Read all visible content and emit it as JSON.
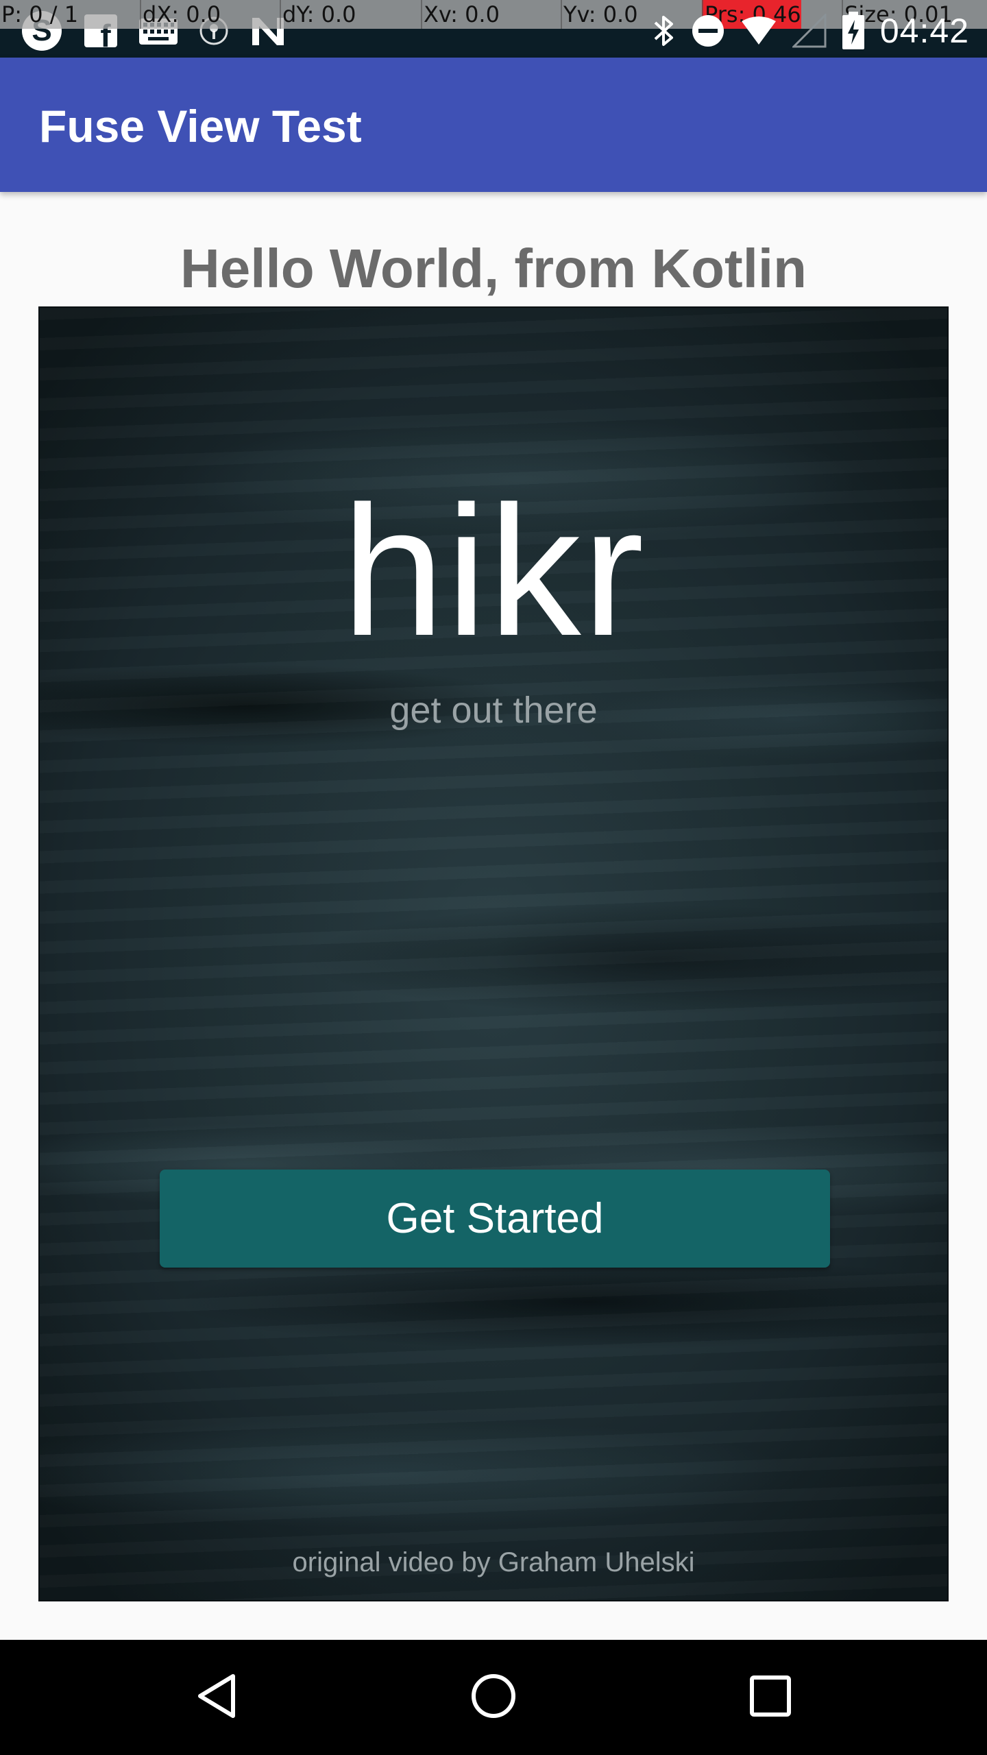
{
  "status_bar": {
    "debug": {
      "pointers": "P: 0 / 1",
      "dx": "dX: 0.0",
      "dy": "dY: 0.0",
      "xv": "Xv: 0.0",
      "yv": "Yv: 0.0",
      "pressure": "Prs: 0.46",
      "size": "Size: 0.01"
    },
    "left_icons": [
      "skype-icon",
      "facebook-icon",
      "keyboard-icon",
      "vpn-key-icon",
      "n-app-icon"
    ],
    "right_icons": [
      "bluetooth-icon",
      "do-not-disturb-icon",
      "wifi-icon",
      "cell-signal-icon",
      "battery-charging-icon"
    ],
    "clock": "04:42"
  },
  "app_bar": {
    "title": "Fuse View Test",
    "color": "#3f51b5"
  },
  "content": {
    "heading": "Hello World, from Kotlin",
    "fuse_view": {
      "logo": "hikr",
      "tagline": "get out there",
      "button_label": "Get Started",
      "button_color": "#146466",
      "credit": "original video by Graham Uhelski"
    }
  },
  "nav_bar": {
    "buttons": [
      "back-icon",
      "home-icon",
      "recents-icon"
    ]
  }
}
